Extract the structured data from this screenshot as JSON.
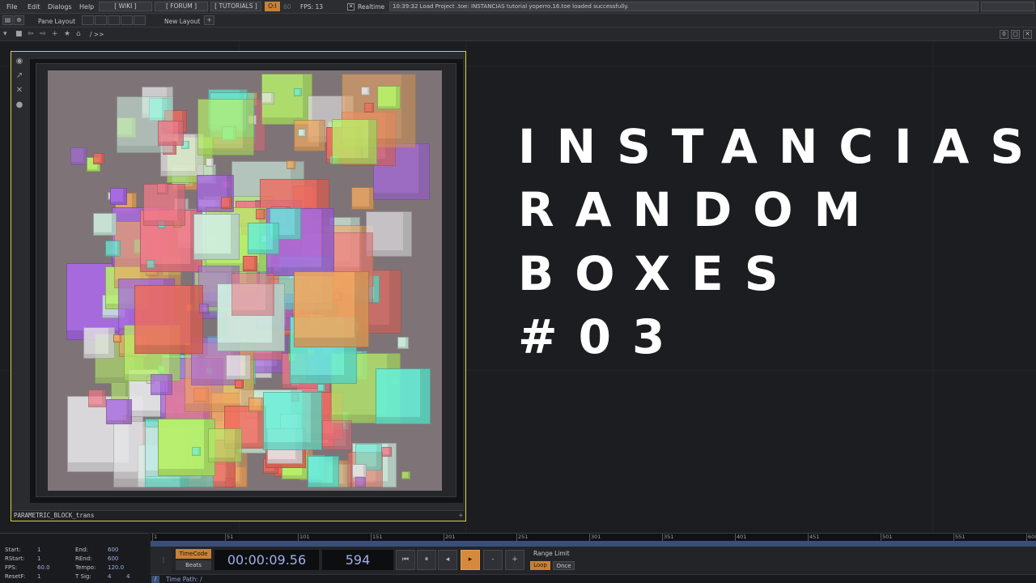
{
  "menu": {
    "items": [
      "File",
      "Edit",
      "Dialogs",
      "Help"
    ],
    "wiki": "[ WIKI ]",
    "forum": "[ FORUM ]",
    "tutorials": "[ TUTORIALS ]",
    "oi": "O:I",
    "fps_cap": "60",
    "fps_readout": "FPS:  13",
    "realtime": "Realtime",
    "status": "10:39:32 Load Project .toe: INSTANCIAS tutorial yoperro.16.toe loaded successfully."
  },
  "panebar": {
    "pane_layout": "Pane Layout",
    "new_layout": "New Layout",
    "add": "+"
  },
  "pathbar": {
    "path": "/ >>",
    "right_btn": "0"
  },
  "operator": {
    "name": "PARAMETRIC_BLOCK_trans",
    "plus": "+"
  },
  "title": {
    "line1": "INSTANCIAS",
    "line2": "RANDOM",
    "line3": "BOXES",
    "line4": "#03"
  },
  "timeline": {
    "ticks": [
      "1",
      "51",
      "101",
      "151",
      "201",
      "251",
      "301",
      "351",
      "401",
      "451",
      "501",
      "551",
      "600"
    ],
    "info": {
      "start_label": "Start:",
      "start": "1",
      "end_label": "End:",
      "end": "600",
      "rstart_label": "RStart:",
      "rstart": "1",
      "rend_label": "REnd:",
      "rend": "600",
      "fps_label": "FPS:",
      "fps": "60.0",
      "tempo_label": "Tempo:",
      "tempo": "120.0",
      "resetf_label": "ResetF:",
      "resetf": "1",
      "tsig_label": "T Sig:",
      "tsig_a": "4",
      "tsig_b": "4"
    },
    "timecode_badge": "TimeCode",
    "beats_badge": "Beats",
    "timecode": "00:00:09.56",
    "frame": "594",
    "range_limit": "Range Limit",
    "loop": "Loop",
    "once": "Once",
    "time_path": "Time Path: /"
  },
  "colors": {
    "accent_orange": "#c98136",
    "selection_yellow": "#d7cf3a",
    "readout_blue": "#9fb0e8",
    "box_palette": [
      "#f06b5e",
      "#66f0d8",
      "#b8f06a",
      "#e8e8ea",
      "#a86ae0",
      "#f0a860",
      "#f07a88",
      "#cfeee0"
    ]
  }
}
